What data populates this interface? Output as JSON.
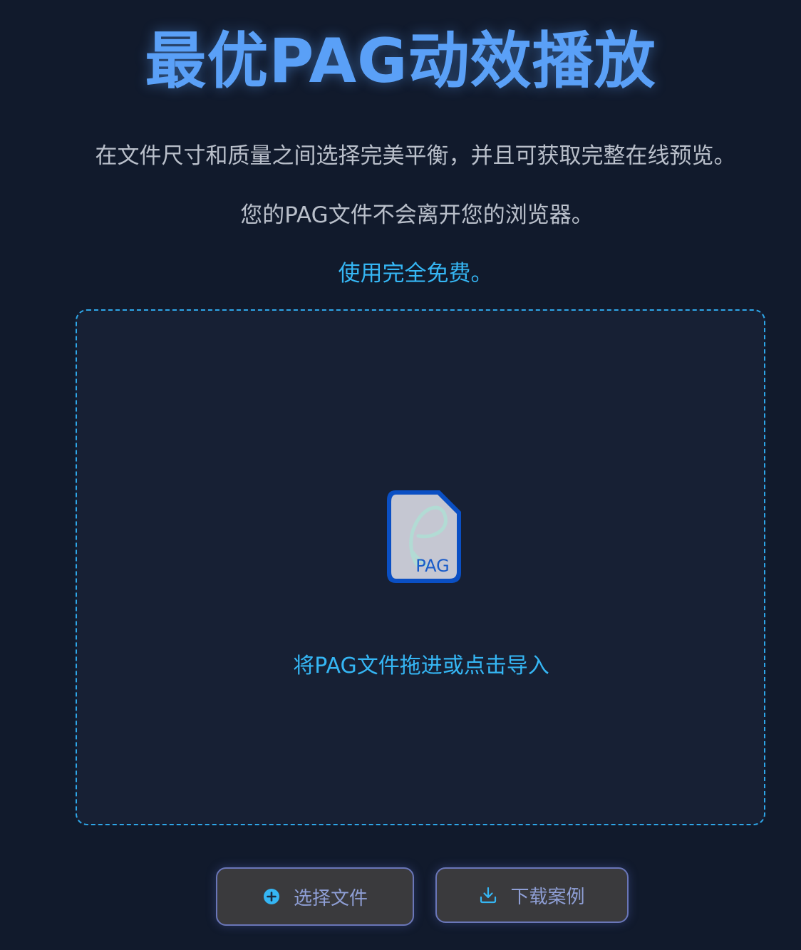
{
  "header": {
    "title": "最优PAG动效播放",
    "subtitle_1": "在文件尺寸和质量之间选择完美平衡，并且可获取完整在线预览。",
    "subtitle_2": "您的PAG文件不会离开您的浏览器。",
    "free_note": "使用完全免费。"
  },
  "dropzone": {
    "file_badge": "PAG",
    "label": "将PAG文件拖进或点击导入"
  },
  "actions": {
    "select_label": "选择文件",
    "select_icon": "plus-circle-icon",
    "download_label": "下载案例",
    "download_icon": "download-icon"
  },
  "colors": {
    "background": "#111a2c",
    "title": "#5aa0f7",
    "accent": "#35b6f4",
    "dropzone_border": "#2ea6e8",
    "button_border": "#6a76b8"
  }
}
